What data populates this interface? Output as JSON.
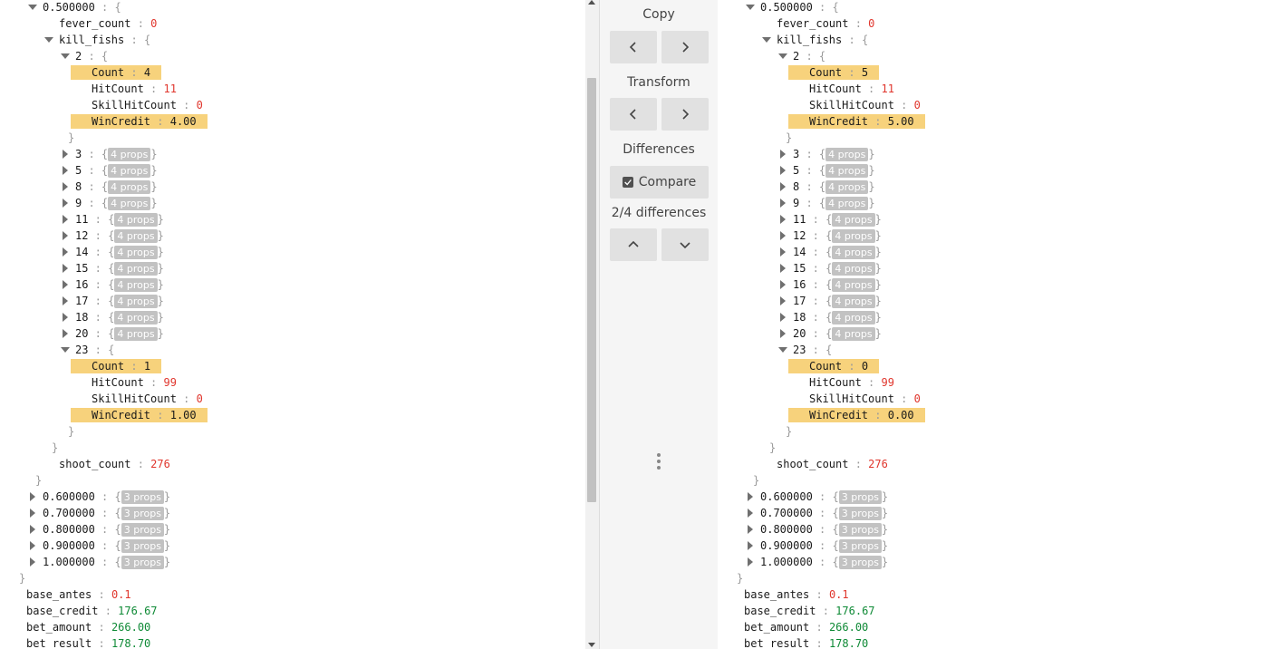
{
  "toolbar": {
    "copy_label": "Copy",
    "transform_label": "Transform",
    "differences_label": "Differences",
    "compare_label": "Compare",
    "compare_checked": true,
    "diff_counter": "2/4 differences"
  },
  "panes": {
    "left": [
      {
        "d": 1,
        "t": "e",
        "k": "0.500000",
        "b": "{"
      },
      {
        "d": 2,
        "k": "fever_count",
        "v": "0",
        "c": "num"
      },
      {
        "d": 2,
        "t": "e",
        "k": "kill_fishs",
        "b": "{"
      },
      {
        "d": 3,
        "t": "e",
        "k": "2 ",
        "b": "{"
      },
      {
        "d": 4,
        "k": "Count",
        "v": "4",
        "c": "num",
        "x": true
      },
      {
        "d": 4,
        "k": "HitCount",
        "v": "11",
        "c": "num"
      },
      {
        "d": 4,
        "k": "SkillHitCount",
        "v": "0",
        "c": "num"
      },
      {
        "d": 4,
        "k": "WinCredit",
        "v": "4.00",
        "c": "str",
        "x": true
      },
      {
        "d": 3,
        "b": "}"
      },
      {
        "d": 3,
        "t": "c",
        "k": "3 ",
        "p": "4 props"
      },
      {
        "d": 3,
        "t": "c",
        "k": "5 ",
        "p": "4 props"
      },
      {
        "d": 3,
        "t": "c",
        "k": "8 ",
        "p": "4 props"
      },
      {
        "d": 3,
        "t": "c",
        "k": "9 ",
        "p": "4 props"
      },
      {
        "d": 3,
        "t": "c",
        "k": "11",
        "p": "4 props"
      },
      {
        "d": 3,
        "t": "c",
        "k": "12",
        "p": "4 props"
      },
      {
        "d": 3,
        "t": "c",
        "k": "14",
        "p": "4 props"
      },
      {
        "d": 3,
        "t": "c",
        "k": "15",
        "p": "4 props"
      },
      {
        "d": 3,
        "t": "c",
        "k": "16",
        "p": "4 props"
      },
      {
        "d": 3,
        "t": "c",
        "k": "17",
        "p": "4 props"
      },
      {
        "d": 3,
        "t": "c",
        "k": "18",
        "p": "4 props"
      },
      {
        "d": 3,
        "t": "c",
        "k": "20",
        "p": "4 props"
      },
      {
        "d": 3,
        "t": "e",
        "k": "23",
        "b": "{"
      },
      {
        "d": 4,
        "k": "Count",
        "v": "1",
        "c": "num",
        "x": true
      },
      {
        "d": 4,
        "k": "HitCount",
        "v": "99",
        "c": "num"
      },
      {
        "d": 4,
        "k": "SkillHitCount",
        "v": "0",
        "c": "num"
      },
      {
        "d": 4,
        "k": "WinCredit",
        "v": "1.00",
        "c": "str",
        "x": true
      },
      {
        "d": 3,
        "b": "}"
      },
      {
        "d": 2,
        "b": "}"
      },
      {
        "d": 2,
        "k": "shoot_count",
        "v": "276",
        "c": "num"
      },
      {
        "d": 1,
        "b": "}"
      },
      {
        "d": 1,
        "t": "c",
        "k": "0.600000",
        "p": "3 props"
      },
      {
        "d": 1,
        "t": "c",
        "k": "0.700000",
        "p": "3 props"
      },
      {
        "d": 1,
        "t": "c",
        "k": "0.800000",
        "p": "3 props"
      },
      {
        "d": 1,
        "t": "c",
        "k": "0.900000",
        "p": "3 props"
      },
      {
        "d": 1,
        "t": "c",
        "k": "1.000000",
        "p": "3 props"
      },
      {
        "d": 0,
        "b": "}"
      },
      {
        "d": 0,
        "k": "base_antes",
        "v": "0.1",
        "c": "num"
      },
      {
        "d": 0,
        "k": "base_credit",
        "v": "176.67",
        "c": "str"
      },
      {
        "d": 0,
        "k": "bet_amount",
        "v": "266.00",
        "c": "str"
      },
      {
        "d": 0,
        "k": "bet_result",
        "v": "178.70",
        "c": "str"
      }
    ],
    "right": [
      {
        "d": 1,
        "t": "e",
        "k": "0.500000",
        "b": "{"
      },
      {
        "d": 2,
        "k": "fever_count",
        "v": "0",
        "c": "num"
      },
      {
        "d": 2,
        "t": "e",
        "k": "kill_fishs",
        "b": "{"
      },
      {
        "d": 3,
        "t": "e",
        "k": "2 ",
        "b": "{"
      },
      {
        "d": 4,
        "k": "Count",
        "v": "5",
        "c": "num",
        "x": true
      },
      {
        "d": 4,
        "k": "HitCount",
        "v": "11",
        "c": "num"
      },
      {
        "d": 4,
        "k": "SkillHitCount",
        "v": "0",
        "c": "num"
      },
      {
        "d": 4,
        "k": "WinCredit",
        "v": "5.00",
        "c": "str",
        "x": true
      },
      {
        "d": 3,
        "b": "}"
      },
      {
        "d": 3,
        "t": "c",
        "k": "3 ",
        "p": "4 props"
      },
      {
        "d": 3,
        "t": "c",
        "k": "5 ",
        "p": "4 props"
      },
      {
        "d": 3,
        "t": "c",
        "k": "8 ",
        "p": "4 props"
      },
      {
        "d": 3,
        "t": "c",
        "k": "9 ",
        "p": "4 props"
      },
      {
        "d": 3,
        "t": "c",
        "k": "11",
        "p": "4 props"
      },
      {
        "d": 3,
        "t": "c",
        "k": "12",
        "p": "4 props"
      },
      {
        "d": 3,
        "t": "c",
        "k": "14",
        "p": "4 props"
      },
      {
        "d": 3,
        "t": "c",
        "k": "15",
        "p": "4 props"
      },
      {
        "d": 3,
        "t": "c",
        "k": "16",
        "p": "4 props"
      },
      {
        "d": 3,
        "t": "c",
        "k": "17",
        "p": "4 props"
      },
      {
        "d": 3,
        "t": "c",
        "k": "18",
        "p": "4 props"
      },
      {
        "d": 3,
        "t": "c",
        "k": "20",
        "p": "4 props"
      },
      {
        "d": 3,
        "t": "e",
        "k": "23",
        "b": "{"
      },
      {
        "d": 4,
        "k": "Count",
        "v": "0",
        "c": "num",
        "x": true
      },
      {
        "d": 4,
        "k": "HitCount",
        "v": "99",
        "c": "num"
      },
      {
        "d": 4,
        "k": "SkillHitCount",
        "v": "0",
        "c": "num"
      },
      {
        "d": 4,
        "k": "WinCredit",
        "v": "0.00",
        "c": "str",
        "x": true
      },
      {
        "d": 3,
        "b": "}"
      },
      {
        "d": 2,
        "b": "}"
      },
      {
        "d": 2,
        "k": "shoot_count",
        "v": "276",
        "c": "num"
      },
      {
        "d": 1,
        "b": "}"
      },
      {
        "d": 1,
        "t": "c",
        "k": "0.600000",
        "p": "3 props"
      },
      {
        "d": 1,
        "t": "c",
        "k": "0.700000",
        "p": "3 props"
      },
      {
        "d": 1,
        "t": "c",
        "k": "0.800000",
        "p": "3 props"
      },
      {
        "d": 1,
        "t": "c",
        "k": "0.900000",
        "p": "3 props"
      },
      {
        "d": 1,
        "t": "c",
        "k": "1.000000",
        "p": "3 props"
      },
      {
        "d": 0,
        "b": "}"
      },
      {
        "d": 0,
        "k": "base_antes",
        "v": "0.1",
        "c": "num"
      },
      {
        "d": 0,
        "k": "base_credit",
        "v": "176.67",
        "c": "str"
      },
      {
        "d": 0,
        "k": "bet_amount",
        "v": "266.00",
        "c": "str"
      },
      {
        "d": 0,
        "k": "bet_result",
        "v": "178.70",
        "c": "str"
      }
    ]
  }
}
